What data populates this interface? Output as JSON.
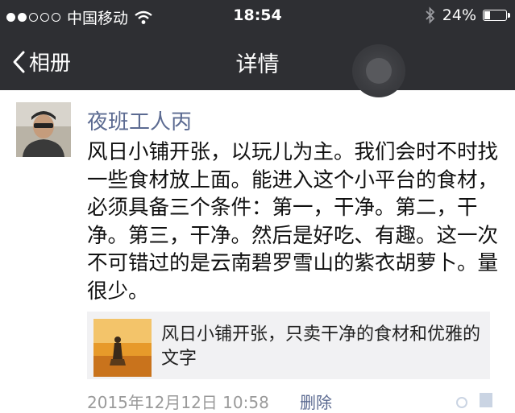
{
  "status_bar": {
    "carrier": "中国移动",
    "time": "18:54",
    "battery_percent": "24%",
    "battery_level": 0.24,
    "signal_bars_filled": 2,
    "signal_bars_total": 5
  },
  "nav": {
    "back_label": "相册",
    "title": "详情"
  },
  "post": {
    "username": "夜班工人丙",
    "text": "风日小铺开张，以玩儿为主。我们会时不时找一些食材放上面。能进入这个小平台的食材，必须具备三个条件：第一，干净。第二，干净。第三，干净。然后是好吃、有趣。这一次不可错过的是云南碧罗雪山的紫衣胡萝卜。量很少。",
    "link_title": "风日小铺开张，只卖干净的食材和优雅的文字",
    "timestamp": "2015年12月12日 10:58",
    "delete_label": "删除"
  },
  "colors": {
    "header_bg": "#2e2f33",
    "username": "#5b6a91",
    "card_bg": "#f1f1f3"
  }
}
